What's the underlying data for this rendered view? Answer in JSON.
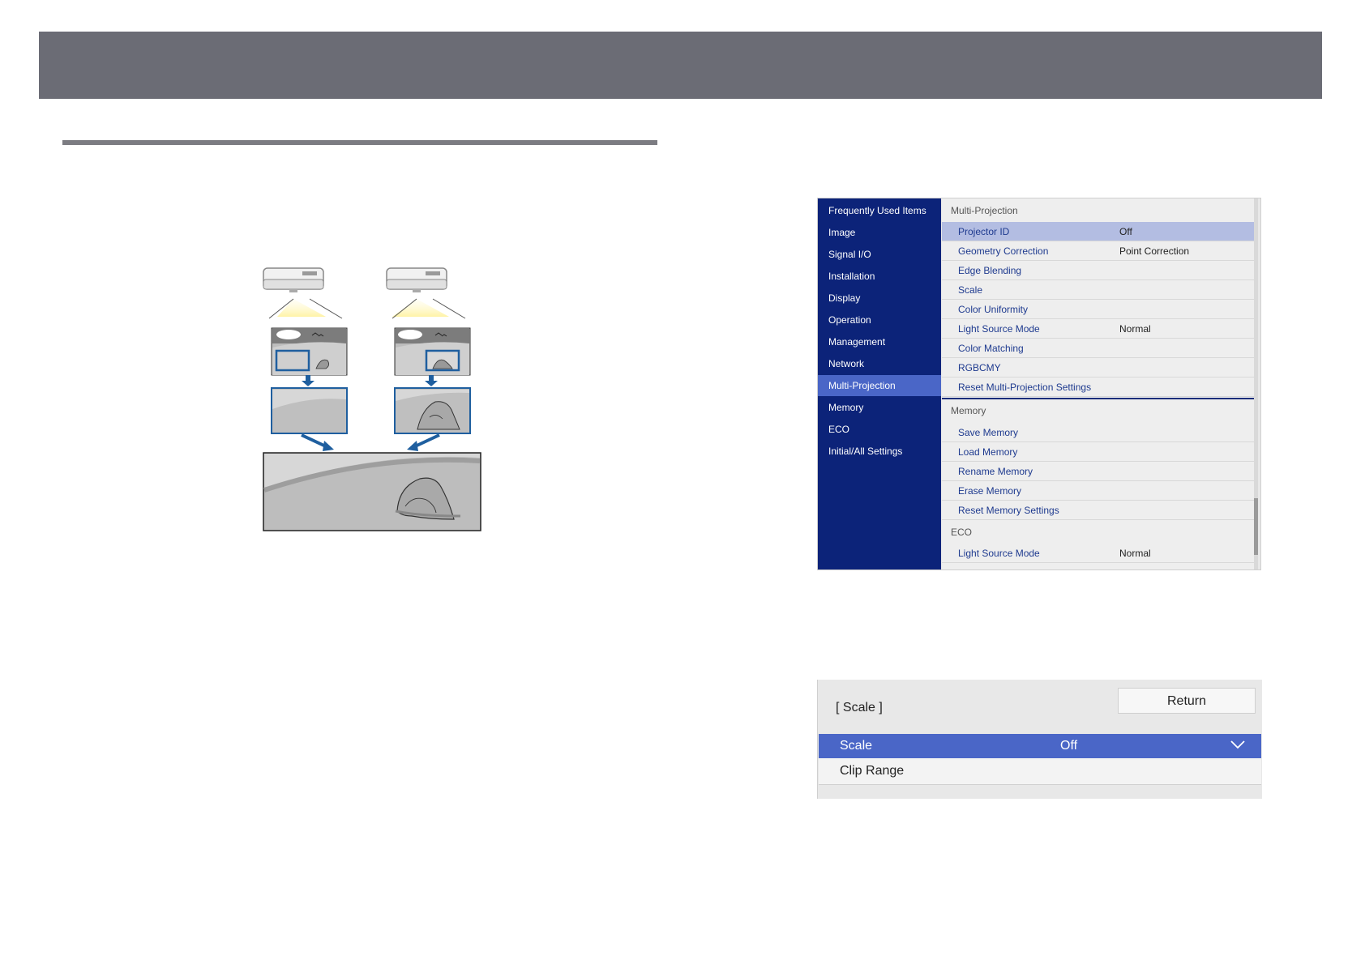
{
  "menu": {
    "side_items": [
      {
        "label": "Frequently Used Items"
      },
      {
        "label": "Image"
      },
      {
        "label": "Signal I/O"
      },
      {
        "label": "Installation"
      },
      {
        "label": "Display"
      },
      {
        "label": "Operation"
      },
      {
        "label": "Management"
      },
      {
        "label": "Network"
      },
      {
        "label": "Multi-Projection"
      },
      {
        "label": "Memory"
      },
      {
        "label": "ECO"
      },
      {
        "label": "Initial/All Settings"
      }
    ],
    "selected_side_item": "Multi-Projection",
    "sections": [
      {
        "title": "Multi-Projection",
        "rows": [
          {
            "label": "Projector ID",
            "value": "Off"
          },
          {
            "label": "Geometry Correction",
            "value": "Point Correction"
          },
          {
            "label": "Edge Blending",
            "value": ""
          },
          {
            "label": "Scale",
            "value": ""
          },
          {
            "label": "Color Uniformity",
            "value": ""
          },
          {
            "label": "Light Source Mode",
            "value": "Normal"
          },
          {
            "label": "Color Matching",
            "value": ""
          },
          {
            "label": "RGBCMY",
            "value": ""
          },
          {
            "label": "Reset Multi-Projection Settings",
            "value": ""
          }
        ]
      },
      {
        "title": "Memory",
        "rows": [
          {
            "label": "Save Memory",
            "value": ""
          },
          {
            "label": "Load Memory",
            "value": ""
          },
          {
            "label": "Rename Memory",
            "value": ""
          },
          {
            "label": "Erase Memory",
            "value": ""
          },
          {
            "label": "Reset Memory Settings",
            "value": ""
          }
        ]
      },
      {
        "title": "ECO",
        "rows": [
          {
            "label": "Light Source Mode",
            "value": "Normal"
          }
        ]
      }
    ]
  },
  "scale_dialog": {
    "title": "[ Scale ]",
    "return_label": "Return",
    "scale_label": "Scale",
    "scale_value": "Off",
    "clip_range_label": "Clip Range"
  },
  "colors": {
    "header_bar": "#6b6c75",
    "menu_sidebar": "#0c2379",
    "menu_selected": "#4a66c7",
    "row_selected": "#b3bde2",
    "item_text": "#1e3a8f"
  }
}
